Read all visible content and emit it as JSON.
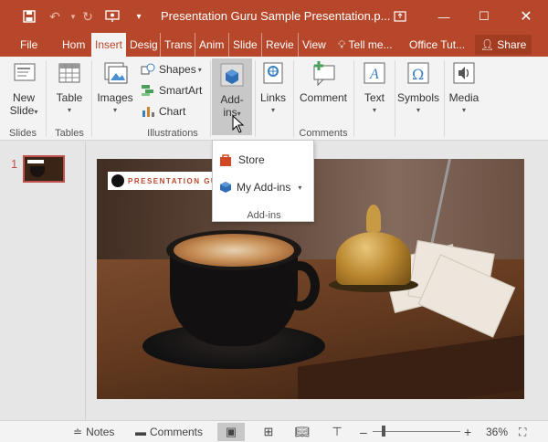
{
  "window": {
    "title": "Presentation Guru Sample Presentation.p...",
    "controls": [
      "restore-ribbon",
      "minimize",
      "maximize",
      "close"
    ]
  },
  "tabs": [
    {
      "label": "File"
    },
    {
      "label": "Hom"
    },
    {
      "label": "Insert",
      "active": true
    },
    {
      "label": "Desig"
    },
    {
      "label": "Trans"
    },
    {
      "label": "Anim"
    },
    {
      "label": "Slide"
    },
    {
      "label": "Revie"
    },
    {
      "label": "View"
    },
    {
      "label": "Tell me..."
    },
    {
      "label": "Office Tut..."
    }
  ],
  "share_label": "Share",
  "ribbon": {
    "new_slide_line1": "New",
    "new_slide_line2": "Slide",
    "slides_group": "Slides",
    "table": "Table",
    "tables_group": "Tables",
    "images": "Images",
    "shapes": "Shapes",
    "smartart": "SmartArt",
    "chart": "Chart",
    "illustrations_group": "Illustrations",
    "addins_line1": "Add-",
    "addins_line2": "ins",
    "links": "Links",
    "comment": "Comment",
    "comments_group": "Comments",
    "text": "Text",
    "symbols": "Symbols",
    "media": "Media"
  },
  "addins_dropdown": {
    "store": "Store",
    "my_addins": "My Add-ins",
    "group_label": "Add-ins"
  },
  "thumbnail": {
    "number": "1"
  },
  "slide": {
    "logo_text": "PRESENTATION GU"
  },
  "status": {
    "notes": "Notes",
    "comments": "Comments",
    "zoom": "36%"
  },
  "colors": {
    "brand": "#b7472a",
    "ribbon_bg": "#f3f3f3"
  }
}
